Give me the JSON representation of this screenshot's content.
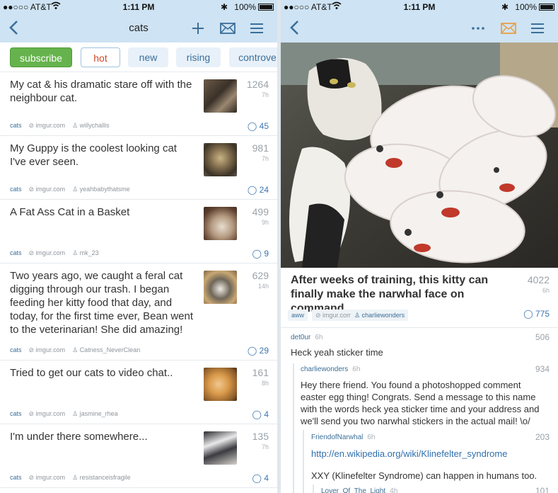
{
  "status": {
    "carrier": "●●○○○ AT&T",
    "time": "1:11 PM",
    "battery": "100%",
    "bluetooth": "✱"
  },
  "left": {
    "nav": {
      "title": "cats"
    },
    "tabs": [
      "subscribe",
      "hot",
      "new",
      "rising",
      "controve"
    ],
    "posts": [
      {
        "title": "My cat & his dramatic stare off with the neighbour cat.",
        "score": "1264",
        "age": "7h",
        "subreddit": "cats",
        "domain": "imgur.com",
        "user": "willychallis",
        "comments": "45"
      },
      {
        "title": "My Guppy is the coolest looking cat I've ever seen.",
        "score": "981",
        "age": "7h",
        "subreddit": "cats",
        "domain": "imgur.com",
        "user": "yeahbabythatsme",
        "comments": "24"
      },
      {
        "title": "A Fat Ass Cat in a Basket",
        "score": "499",
        "age": "9h",
        "subreddit": "cats",
        "domain": "imgur.com",
        "user": "mk_23",
        "comments": "9"
      },
      {
        "title": "Two years ago, we caught a feral cat digging through our trash. I began feeding her kitty food that day, and today, for the first time ever, Bean went to the veterinarian! She did amazing!",
        "score": "629",
        "age": "14h",
        "subreddit": "cats",
        "domain": "imgur.com",
        "user": "Catness_NeverClean",
        "comments": "29"
      },
      {
        "title": "Tried to get our cats to video chat..",
        "score": "161",
        "age": "8h",
        "subreddit": "cats",
        "domain": "imgur.com",
        "user": "jasmine_rhea",
        "comments": "4"
      },
      {
        "title": "I'm under there somewhere...",
        "score": "135",
        "age": "7h",
        "subreddit": "cats",
        "domain": "imgur.com",
        "user": "resistanceisfragile",
        "comments": "4"
      }
    ]
  },
  "right": {
    "post": {
      "title": "After weeks of training, this kitty can finally make the narwhal face on command.",
      "score": "4022",
      "age": "6h",
      "subreddit": "aww",
      "domain": "imgur.com",
      "user": "charliewonders",
      "comments": "775"
    },
    "comments": [
      {
        "user": "det0ur",
        "ago": "6h",
        "score": "506",
        "body": "Heck yeah sticker time"
      },
      {
        "user": "charliewonders",
        "ago": "6h",
        "score": "934",
        "body": "Hey there friend. You found a photoshopped comment easter egg thing! Congrats. Send a message to this name with the words heck yea sticker time and your address and we'll send you two narwhal stickers in the actual mail! \\o/"
      },
      {
        "user": "FriendofNarwhal",
        "ago": "6h",
        "score": "203",
        "link": "http://en.wikipedia.org/wiki/Klinefelter_syndrome",
        "body": "XXY (Klinefelter Syndrome) can happen in humans too."
      },
      {
        "user": "Lover_Of_The_Light",
        "ago": "4h",
        "score": "101"
      }
    ]
  },
  "colors": {
    "header": "#cee3f3",
    "accent": "#3b6f99",
    "subscribe": "#66b34d",
    "hot": "#d14a2b",
    "mail_unread": "#e8a04a"
  }
}
